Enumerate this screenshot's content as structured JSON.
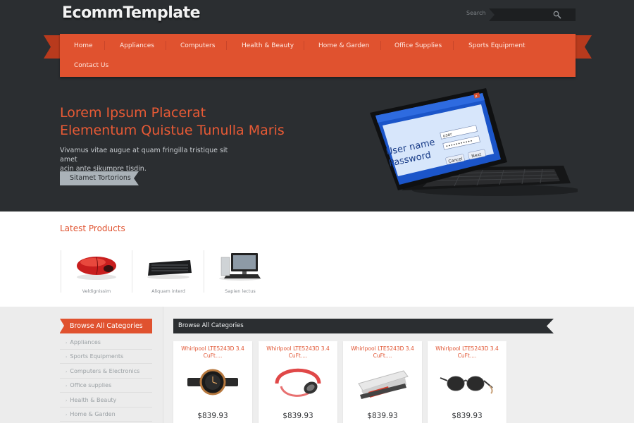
{
  "header": {
    "logo": "EcommTemplate",
    "search_label": "Search"
  },
  "nav": {
    "items": [
      {
        "label": "Home"
      },
      {
        "label": "Appliances"
      },
      {
        "label": "Computers"
      },
      {
        "label": "Health & Beauty"
      },
      {
        "label": "Home & Garden"
      },
      {
        "label": "Office Supplies"
      },
      {
        "label": "Sports Equipment"
      },
      {
        "label": "Contact Us"
      }
    ]
  },
  "hero": {
    "title_line1": "Lorem Ipsum Placerat",
    "title_line2": "Elementum Quistue Tunulla Maris",
    "desc_line1": "Vivamus vitae augue at quam fringilla tristique sit amet",
    "desc_line2": "acin ante sikumpre tisdin.",
    "button": "Sitamet Tortorions",
    "image_text": {
      "user_name": "User name",
      "password": "Password",
      "user_field": "user",
      "cancel": "Cancel",
      "next": "Next",
      "close": "x"
    }
  },
  "latest": {
    "title": "Latest Products",
    "items": [
      {
        "caption": "Veldignissim",
        "icon": "mouse-image"
      },
      {
        "caption": "Aliquam interd",
        "icon": "keyboard-image"
      },
      {
        "caption": "Sapien lectus",
        "icon": "desktop-computer-image"
      }
    ]
  },
  "sidebar": {
    "title": "Browse All Categories",
    "items": [
      {
        "label": "Appliances"
      },
      {
        "label": "Sports Equipments"
      },
      {
        "label": "Computers & Electronics"
      },
      {
        "label": "Office supplies"
      },
      {
        "label": "Health & Beauty"
      },
      {
        "label": "Home & Garden"
      }
    ]
  },
  "catalog": {
    "title": "Browse All Categories",
    "products": [
      {
        "title": "Whirlpool LTE5243D 3.4 CuFt....",
        "price": "$839.93",
        "icon": "watch-image"
      },
      {
        "title": "Whirlpool LTE5243D 3.4 CuFt....",
        "price": "$839.93",
        "icon": "headset-image"
      },
      {
        "title": "Whirlpool LTE5243D 3.4 CuFt....",
        "price": "$839.93",
        "icon": "stapler-image"
      },
      {
        "title": "Whirlpool LTE5243D 3.4 CuFt....",
        "price": "$839.93",
        "icon": "sunglasses-image"
      }
    ]
  },
  "colors": {
    "accent": "#e0522f",
    "dark": "#2b2e31",
    "hero_title": "#e85a35"
  }
}
